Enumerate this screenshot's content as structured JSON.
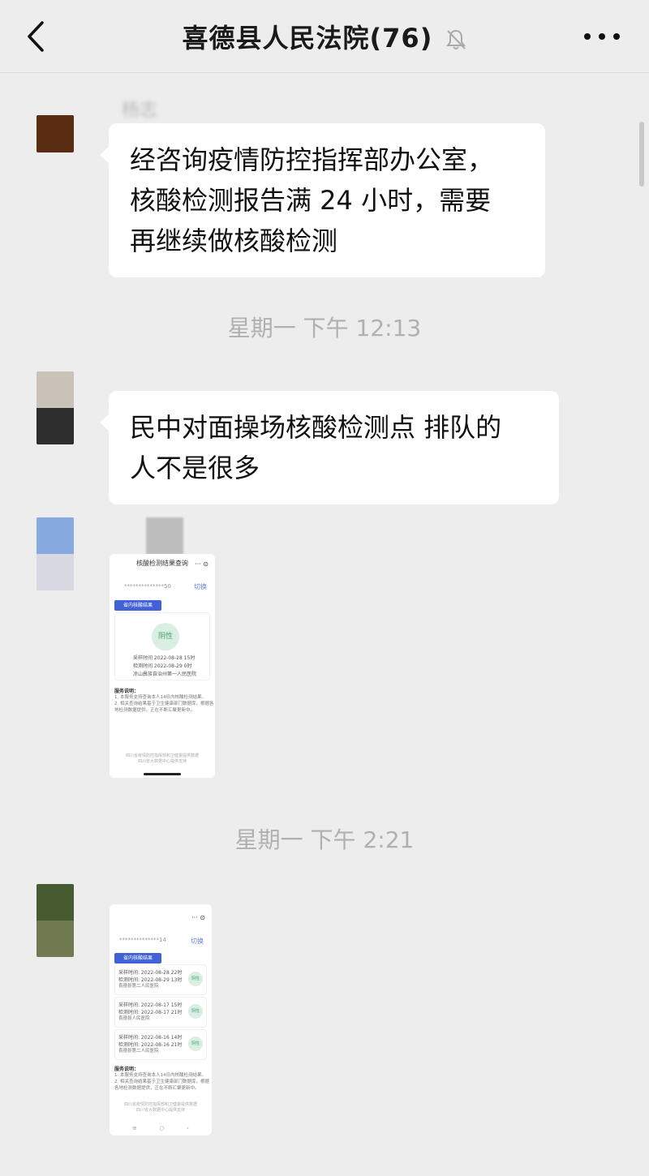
{
  "header": {
    "back_icon": "chevron-left-icon",
    "title": "喜德县人民法院(76)",
    "muted_icon": "bell-slash-icon",
    "more_icon": "ellipsis-icon"
  },
  "messages": [
    {
      "sender_name": "杨志",
      "text_lines": [
        "经咨询疫情防控指挥部办公室，",
        "核酸检测报告满 24 小时，需要",
        "再继续做核酸检测"
      ]
    },
    {
      "timestamp": "星期一 下午 12:13"
    },
    {
      "text_lines": [
        "民中对面操场核酸检测点 排队的",
        "人不是很多"
      ]
    },
    {
      "sender_name": "",
      "image": {
        "header": "核酸检测结果查询",
        "id_masked": "**************50",
        "switch_label": "切换",
        "tab_label": "省内核酸结果",
        "result": "阴性",
        "sample_time": "采样时间 2022-08-28 15时",
        "test_time": "检测时间 2022-08-29 0时",
        "institution": "凉山彝族自治州第一人民医院",
        "notes_title": "服务说明：",
        "notes": [
          "1. 本服务支持查询本人14日内核酸检测结果。",
          "2. 相关查询结果基于卫生健康部门数据库，根据各",
          "地检测数据提供，正在不断汇聚更新中。"
        ],
        "footer": [
          "四川省疫情防控指挥部和卫健委提供数据",
          "四川省大数据中心提供支持"
        ]
      }
    },
    {
      "timestamp": "星期一 下午 2:21"
    },
    {
      "image": {
        "id_masked": "**************14",
        "switch_label": "切换",
        "tab_label": "省内核酸结果",
        "records": [
          {
            "sample": "采样时间: 2022-08-28 22时",
            "test": "检测时间: 2022-08-29 13时",
            "org": "喜德县第二人民医院",
            "result": "阴性"
          },
          {
            "sample": "采样时间: 2022-08-17 15时",
            "test": "检测时间: 2022-08-17 21时",
            "org": "喜德县人民医院",
            "result": "阴性"
          },
          {
            "sample": "采样时间: 2022-08-16 14时",
            "test": "检测时间: 2022-08-16 21时",
            "org": "喜德县第二人民医院",
            "result": "阴性"
          }
        ],
        "notes_title": "服务说明：",
        "notes": [
          "1. 本服务支持查询本人14日内核酸检测结果。",
          "2. 相关查询结果基于卫生健康部门数据库，根据",
          "各地检测数据提供，正在不断汇聚更新中。"
        ],
        "footer": [
          "四川省疫情防控指挥部和卫健委提供数据",
          "四川省大数据中心提供支持"
        ]
      }
    }
  ],
  "colors": {
    "background": "#ededed",
    "bubble": "#ffffff",
    "timestamp": "#b0b0b0",
    "avatar1": "#5a2d12",
    "avatar2_top": "#c9c2b8",
    "avatar2_bottom": "#2e2e2e",
    "avatar3_top": "#86a9e0",
    "avatar3_bottom": "#d8d8e0",
    "avatar4_top": "#485a30",
    "avatar4_bottom": "#6f7a50"
  }
}
